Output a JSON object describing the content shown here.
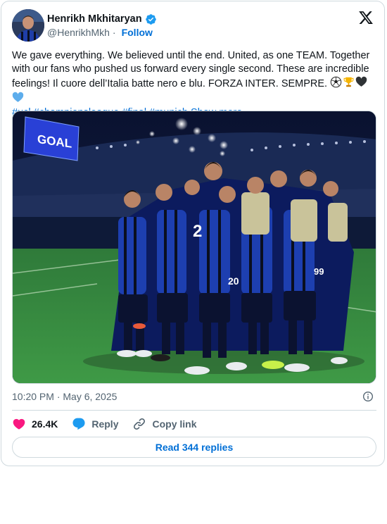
{
  "author": {
    "display_name": "Henrikh Mkhitaryan",
    "handle": "@HenrikhMkh",
    "follow_label": "Follow",
    "verified_color": "#1d9bf0"
  },
  "post": {
    "text_main": "We gave everything. We believed until the end. United, as one TEAM. Together with our fans who pushed us forward every single second. These are incredible feelings! Il cuore dell’Italia batte nero e blu. FORZA INTER. SEMPRE.",
    "emojis": [
      "soccer-ball",
      "trophy",
      "black-heart",
      "blue-heart"
    ],
    "hashtags": [
      "#ucl",
      "#championsleague",
      "#final",
      "#munich"
    ],
    "show_more_label": "Show more",
    "photo_board_text": "GOAL"
  },
  "meta": {
    "timestamp": "10:20 PM · May 6, 2025"
  },
  "actions": {
    "likes_count": "26.4K",
    "reply_label": "Reply",
    "copy_link_label": "Copy link"
  },
  "footer": {
    "read_replies_label": "Read 344 replies"
  },
  "colors": {
    "link": "#006fd6",
    "like": "#f91880",
    "reply": "#1d9bf0",
    "border": "#cfd9de"
  }
}
